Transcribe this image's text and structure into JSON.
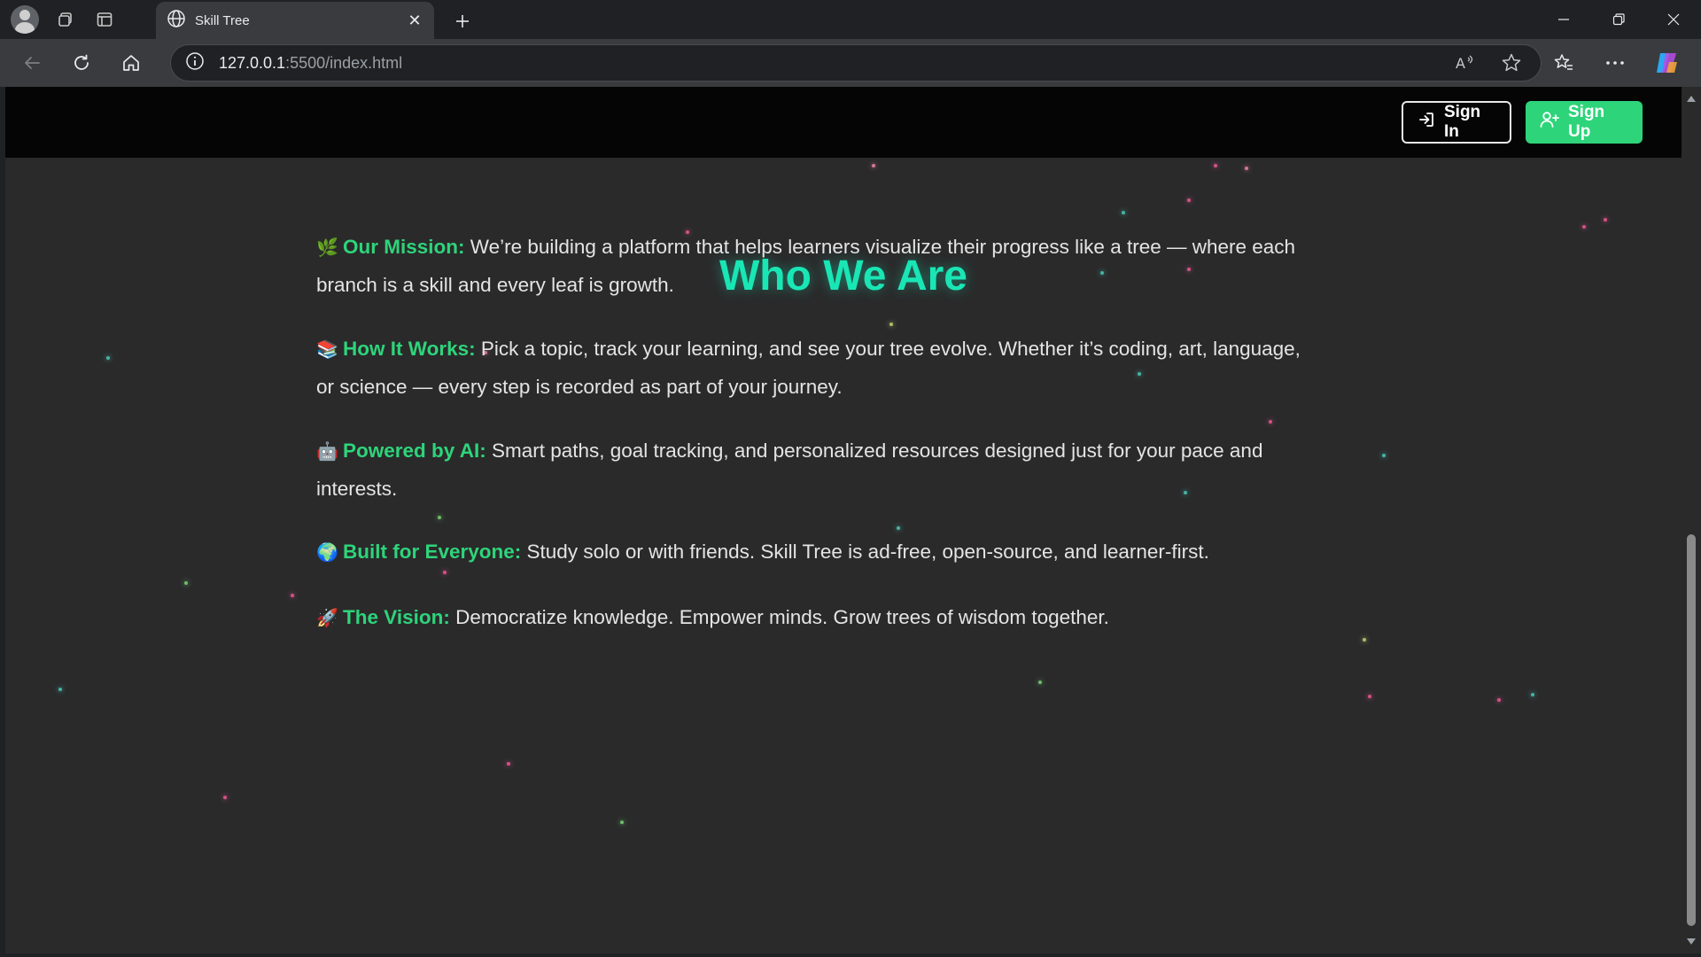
{
  "browser": {
    "tab": {
      "title": "Skill Tree"
    },
    "address": {
      "host": "127.0.0.1",
      "path": ":5500/index.html"
    }
  },
  "header": {
    "signin_label": "Sign In",
    "signup_label": "Sign Up"
  },
  "page": {
    "title": "Who We Are",
    "sections": [
      {
        "emoji": "🌿",
        "label": "Our Mission:",
        "line1": " We’re building a platform that helps learners visualize their progress like a tree — where each",
        "line2": "branch is a skill and every leaf is growth."
      },
      {
        "emoji": "📚",
        "label": "How It Works:",
        "line1": " Pick a topic, track your learning, and see your tree evolve. Whether it’s coding, art, language,",
        "line2": "or science — every step is recorded as part of your journey."
      },
      {
        "emoji": "🤖",
        "label": "Powered by AI:",
        "line1": " Smart paths, goal tracking, and personalized resources designed just for your pace and",
        "line2": "interests."
      },
      {
        "emoji": "🌍",
        "label": "Built for Everyone:",
        "line1": " Study solo or with friends. Skill Tree is ad-free, open-source, and learner-first.",
        "line2": ""
      },
      {
        "emoji": "🚀",
        "label": "The Vision:",
        "line1": " Democratize knowledge. Empower minds. Grow trees of wisdom together.",
        "line2": ""
      }
    ]
  },
  "colors": {
    "accent": "#19e6b5",
    "label": "#2ed47a",
    "header_bg": "#050505",
    "page_bg": "#2a2a2b"
  }
}
